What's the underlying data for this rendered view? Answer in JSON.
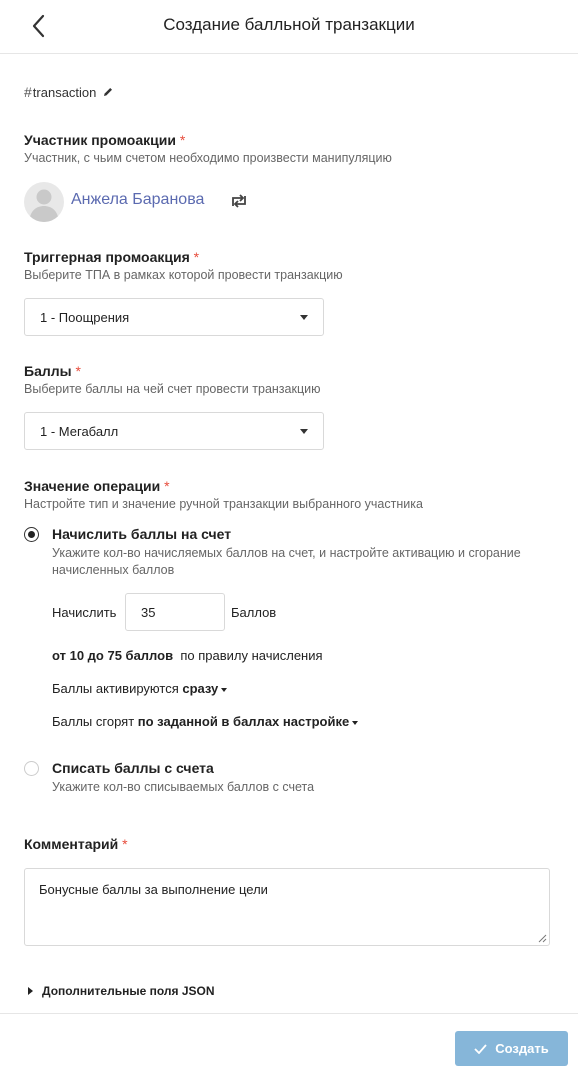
{
  "header": {
    "title": "Создание балльной транзакции"
  },
  "hashtag": "transaction",
  "participant": {
    "label": "Участник промоакции",
    "hint": "Участник, с чьим счетом необходимо произвести манипуляцию",
    "name": "Анжела Баранова"
  },
  "trigger": {
    "label": "Триггерная промоакция",
    "hint": "Выберите ТПА в рамках которой провести транзакцию",
    "selected": "1 - Поощрения"
  },
  "points": {
    "label": "Баллы",
    "hint": "Выберите баллы на чей счет провести транзакцию",
    "selected": "1 - Мегабалл"
  },
  "operation": {
    "label": "Значение операции",
    "hint": "Настройте тип и значение ручной транзакции выбранного участника",
    "accrue": {
      "label": "Начислить баллы на счет",
      "hint": "Укажите кол-во начисляемых баллов на счет, и настройте активацию и сгорание начисленных баллов",
      "amount_prefix": "Начислить",
      "amount_value": "35",
      "amount_suffix": "Баллов",
      "range_bold": "от 10 до 75 баллов",
      "range_rest": "по правилу начисления",
      "activate_prefix": "Баллы активируются",
      "activate_value": "сразу",
      "expire_prefix": "Баллы сгорят",
      "expire_value": "по заданной в баллах настройке"
    },
    "withdraw": {
      "label": "Списать баллы с счета",
      "hint": "Укажите кол-во списываемых баллов с счета"
    }
  },
  "comment": {
    "label": "Комментарий",
    "value": "Бонусные баллы за выполнение цели"
  },
  "json_fields_label": "Дополнительные поля JSON",
  "footer": {
    "create_label": "Создать"
  },
  "colors": {
    "accent_link": "#5b6ab0",
    "required": "#e74c3c",
    "primary_button": "#86b6d9"
  }
}
